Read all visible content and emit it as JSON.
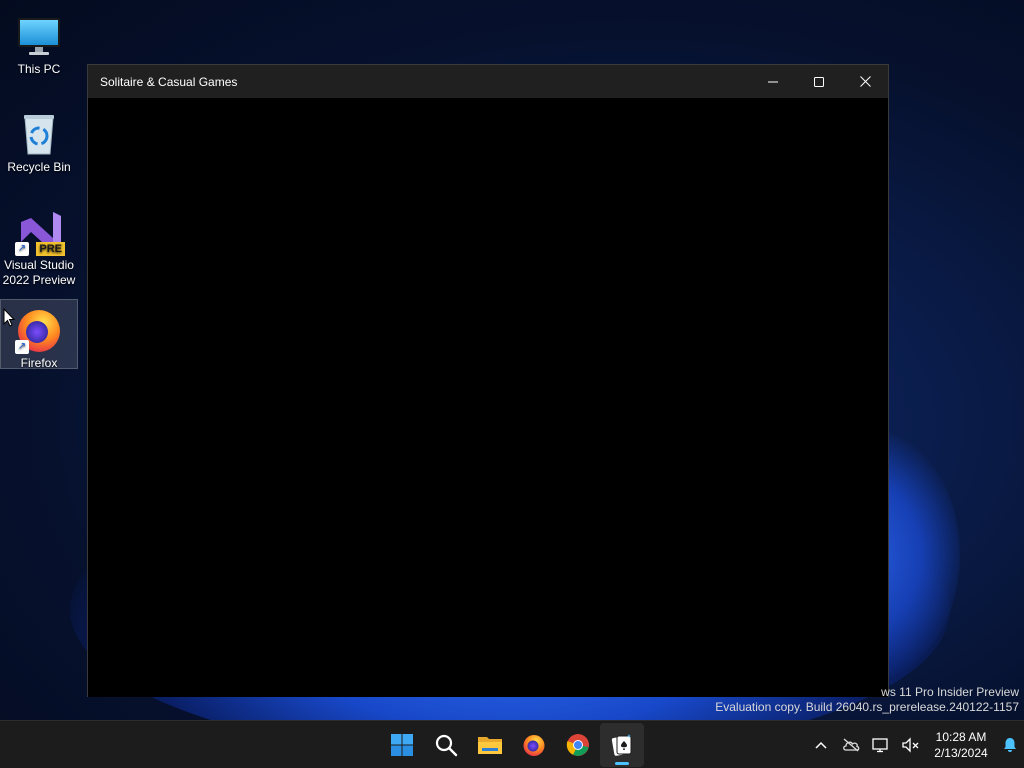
{
  "desktop": {
    "icons": [
      {
        "label": "This PC"
      },
      {
        "label": "Recycle Bin"
      },
      {
        "label": "Visual Studio 2022 Preview",
        "badge": "PRE"
      },
      {
        "label": "Firefox"
      }
    ]
  },
  "window": {
    "title": "Solitaire & Casual Games"
  },
  "watermark": {
    "line1": "ws 11 Pro Insider Preview",
    "line2": "Evaluation copy. Build 26040.rs_prerelease.240122-1157"
  },
  "taskbar": {
    "apps": [
      {
        "name": "start-button",
        "icon": "windows-logo-icon"
      },
      {
        "name": "search-button",
        "icon": "search-icon"
      },
      {
        "name": "file-explorer",
        "icon": "folder-icon"
      },
      {
        "name": "firefox",
        "icon": "firefox-icon"
      },
      {
        "name": "chrome",
        "icon": "chrome-icon"
      },
      {
        "name": "solitaire",
        "icon": "solitaire-icon",
        "active": true
      }
    ],
    "clock": {
      "time": "10:28 AM",
      "date": "2/13/2024"
    }
  },
  "colors": {
    "accent": "#4cc2ff",
    "taskbar": "#1c1c1c",
    "titlebar": "#202020"
  }
}
